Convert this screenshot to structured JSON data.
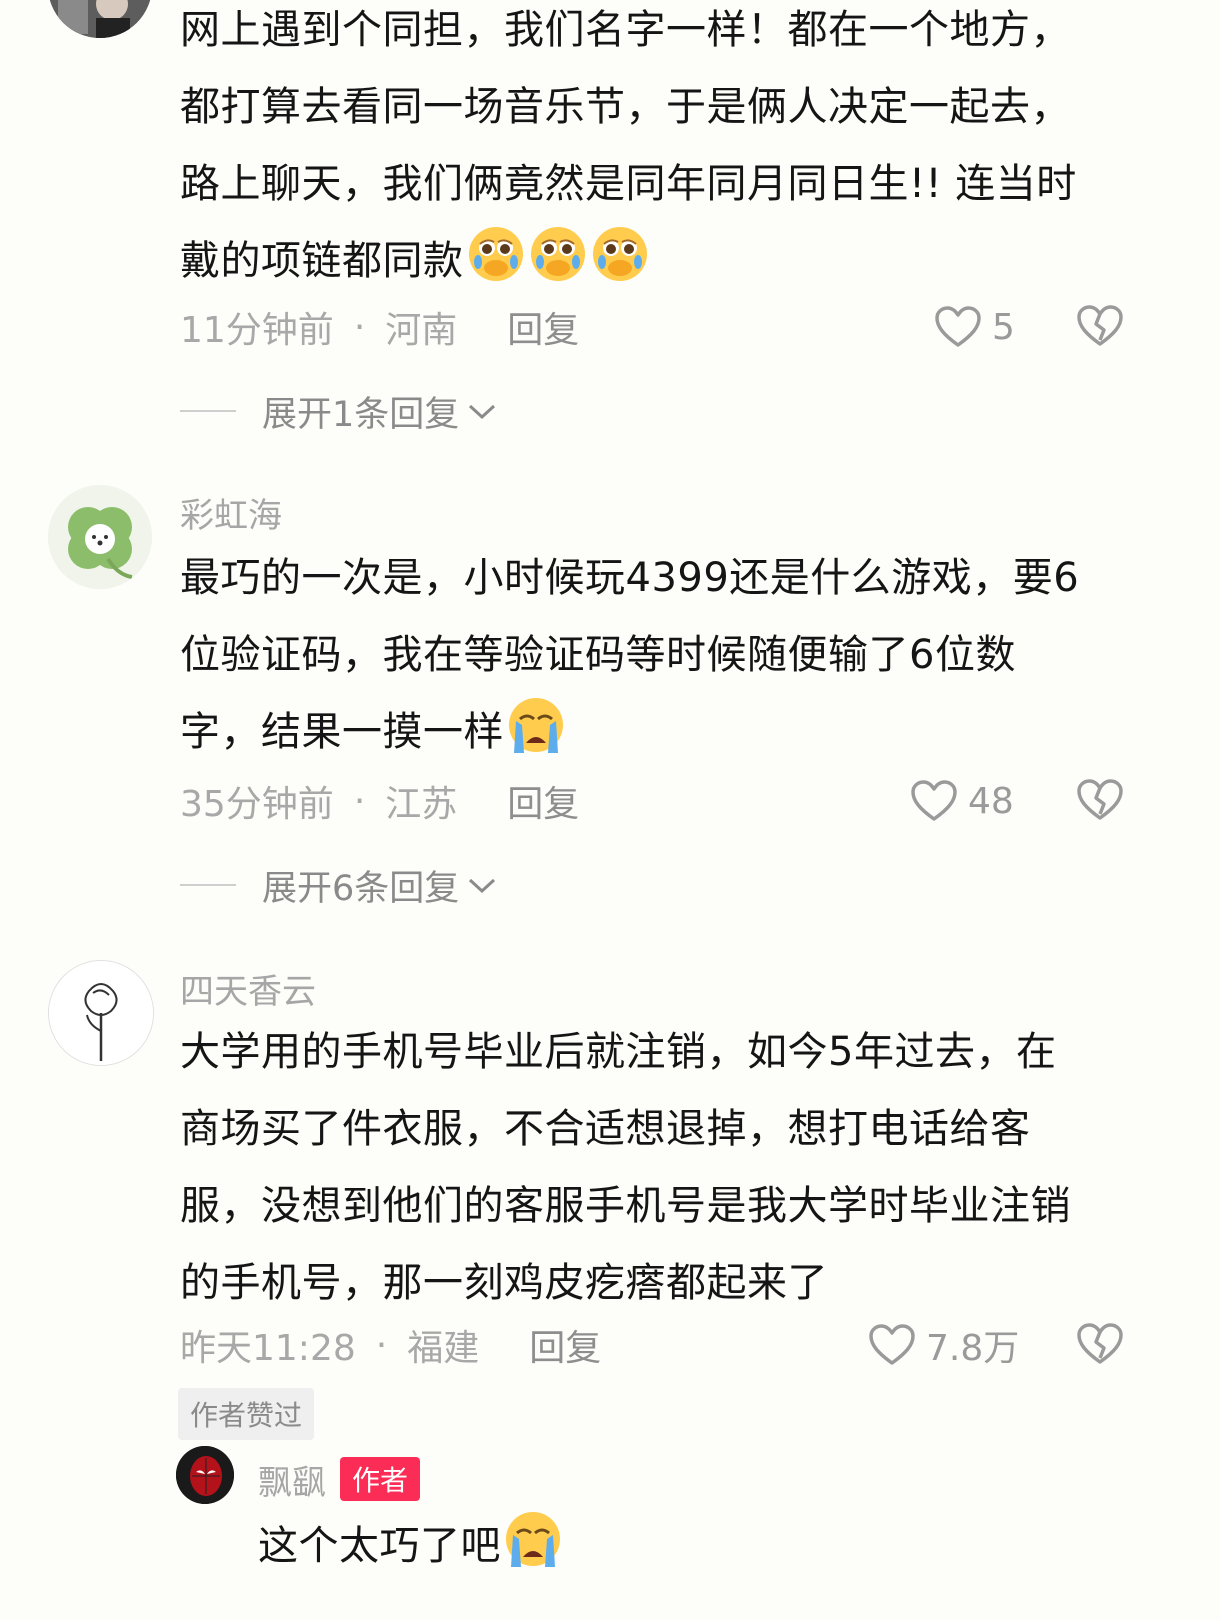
{
  "comment_top": {
    "lines": [
      "网上遇到个同担，我们名字一样！都在一个地方，",
      "都打算去看同一场音乐节，于是俩人决定一起去，",
      "路上聊天，我们俩竟然是同年同月同日生!! 连当时",
      "戴的项链都同款"
    ],
    "emojis": [
      "crying-pleading-emoji",
      "crying-pleading-emoji",
      "crying-pleading-emoji"
    ],
    "time": "11分钟前",
    "location": "河南",
    "reply_label": "回复",
    "likes": "5",
    "expand_label": "展开1条回复"
  },
  "comment_two": {
    "username": "彩虹海",
    "lines": [
      "最巧的一次是，小时候玩4399还是什么游戏，要6",
      "位验证码，我在等验证码等时候随便输了6位数",
      "字，结果一摸一样"
    ],
    "emojis": [
      "loudly-crying-emoji"
    ],
    "time": "35分钟前",
    "location": "江苏",
    "reply_label": "回复",
    "likes": "48",
    "expand_label": "展开6条回复"
  },
  "comment_three": {
    "username": "四天香云",
    "lines": [
      "大学用的手机号毕业后就注销，如今5年过去，在",
      "商场买了件衣服，不合适想退掉，想打电话给客",
      "服，没想到他们的客服手机号是我大学时毕业注销",
      "的手机号，那一刻鸡皮疙瘩都起来了"
    ],
    "time": "昨天11:28",
    "location": "福建",
    "reply_label": "回复",
    "likes": "7.8万",
    "author_liked_label": "作者赞过"
  },
  "reply": {
    "username": "飘飖",
    "author_tag": "作者",
    "text": "这个太巧了吧",
    "emojis": [
      "loudly-crying-emoji"
    ]
  },
  "colors": {
    "background": "#fdfdf9",
    "author_tag": "#fb2c55",
    "meta_text": "#a8a8a8"
  }
}
